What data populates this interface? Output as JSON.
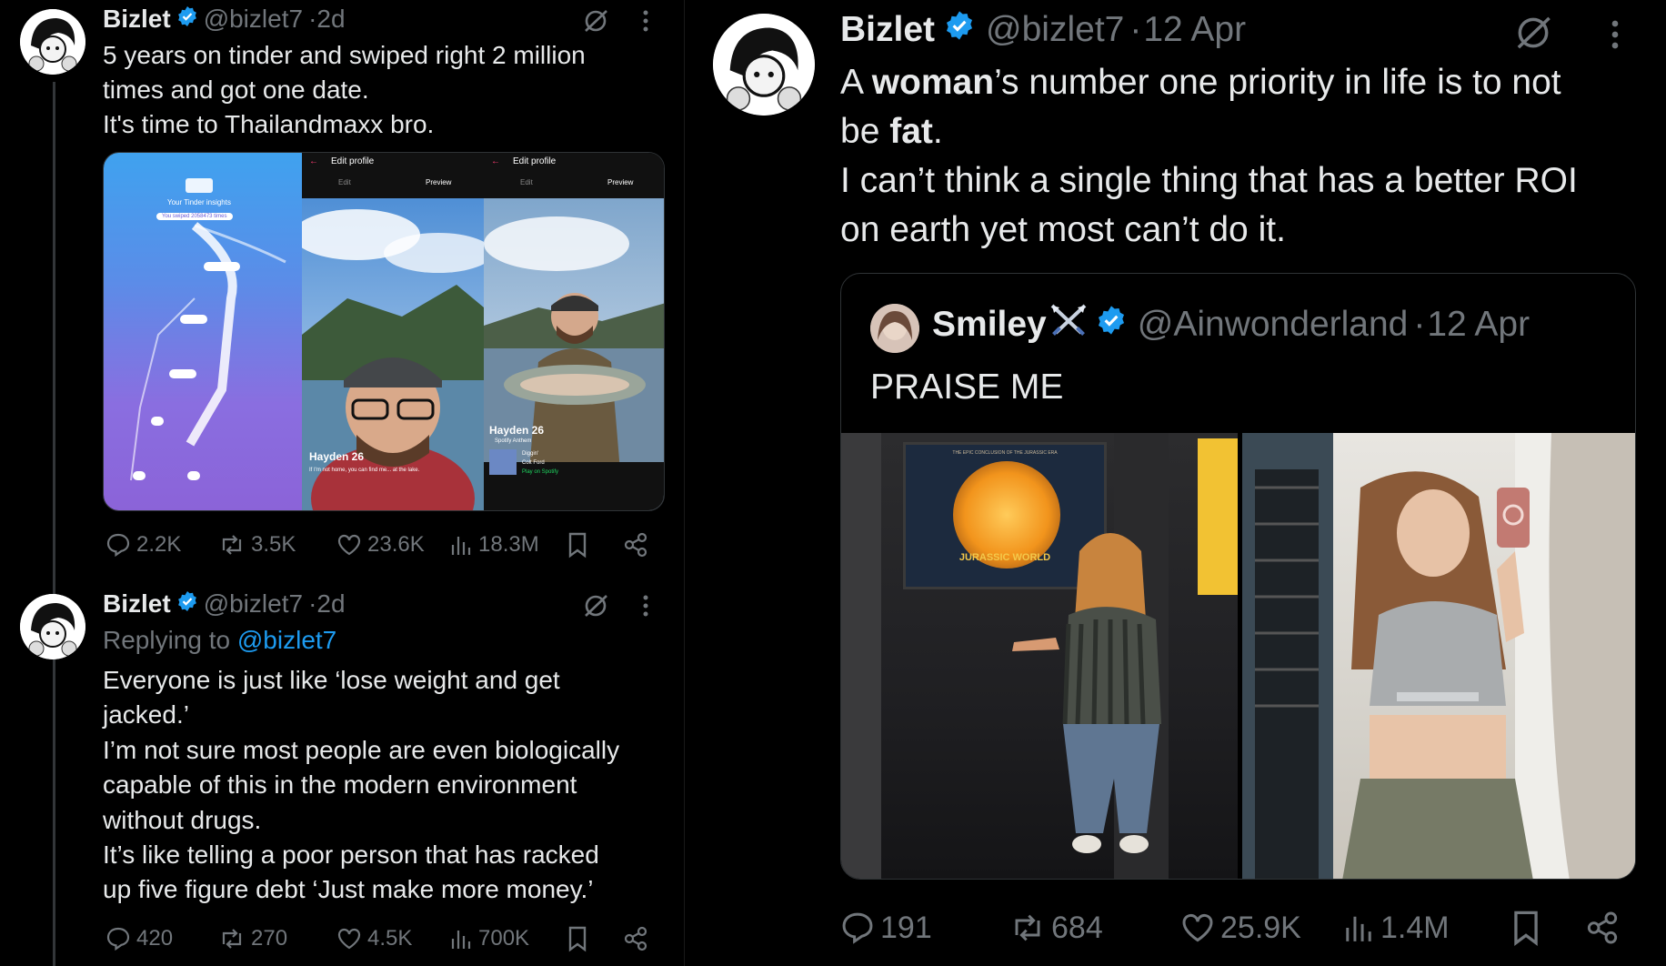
{
  "tweet1": {
    "name": "Bizlet",
    "handle": "@bizlet7",
    "time": "2d",
    "lines": [
      "5 years on tinder and swiped right 2 million",
      "times and got one date.",
      "It's time to Thailandmaxx bro."
    ],
    "media": {
      "insights_title": "Your Tinder insights",
      "swiped_label": "You swiped 2058473 times",
      "panel_a": {
        "header": "Edit profile",
        "tab_edit": "Edit",
        "tab_preview": "Preview",
        "name_age": "Hayden 26",
        "bio": "If I'm not home, you can find me... at the lake."
      },
      "panel_b": {
        "header": "Edit profile",
        "tab_edit": "Edit",
        "tab_preview": "Preview",
        "name_age": "Hayden 26",
        "anthem": "Spotify Anthem",
        "song": "Diggin'",
        "artist": "Colt Ford",
        "play": "Play on Spotify"
      }
    },
    "stats": {
      "replies": "2.2K",
      "reposts": "3.5K",
      "likes": "23.6K",
      "views": "18.3M"
    }
  },
  "tweet2": {
    "name": "Bizlet",
    "handle": "@bizlet7",
    "time": "2d",
    "replying_prefix": "Replying to",
    "replying_handle": "@bizlet7",
    "lines": [
      "Everyone is just like ‘lose weight and get",
      "jacked.’",
      "I’m not sure most people are even biologically",
      "capable of this in the modern environment",
      "without drugs.",
      "It’s like telling a poor person that has racked",
      "up five figure debt ‘Just make more money.’"
    ],
    "stats": {
      "replies": "420",
      "reposts": "270",
      "likes": "4.5K",
      "views": "700K"
    }
  },
  "tweet3": {
    "name": "Bizlet",
    "handle": "@bizlet7",
    "time": "12 Apr",
    "line1_a": "A ",
    "line1_b": "woman",
    "line1_c": "’s number one priority in life is to not",
    "line2_a": "be ",
    "line2_b": "fat",
    "line2_c": ".",
    "line3": "I can’t think a single thing that has a better ROI",
    "line4": "on earth yet most can’t do it.",
    "quote": {
      "name": "Smiley",
      "name_emoji": "⚔️",
      "handle": "@Ainwonderland",
      "time": "12 Apr",
      "text": "PRAISE ME",
      "poster_top": "THE EPIC CONCLUSION OF THE JURASSIC ERA",
      "poster_title": "JURASSIC WORLD"
    },
    "stats": {
      "replies": "191",
      "reposts": "684",
      "likes": "25.9K",
      "views": "1.4M"
    }
  },
  "colors": {
    "bg": "#000000",
    "text": "#e7e9ea",
    "muted": "#71767b",
    "verified": "#1d9bf0",
    "link": "#1d9bf0"
  }
}
